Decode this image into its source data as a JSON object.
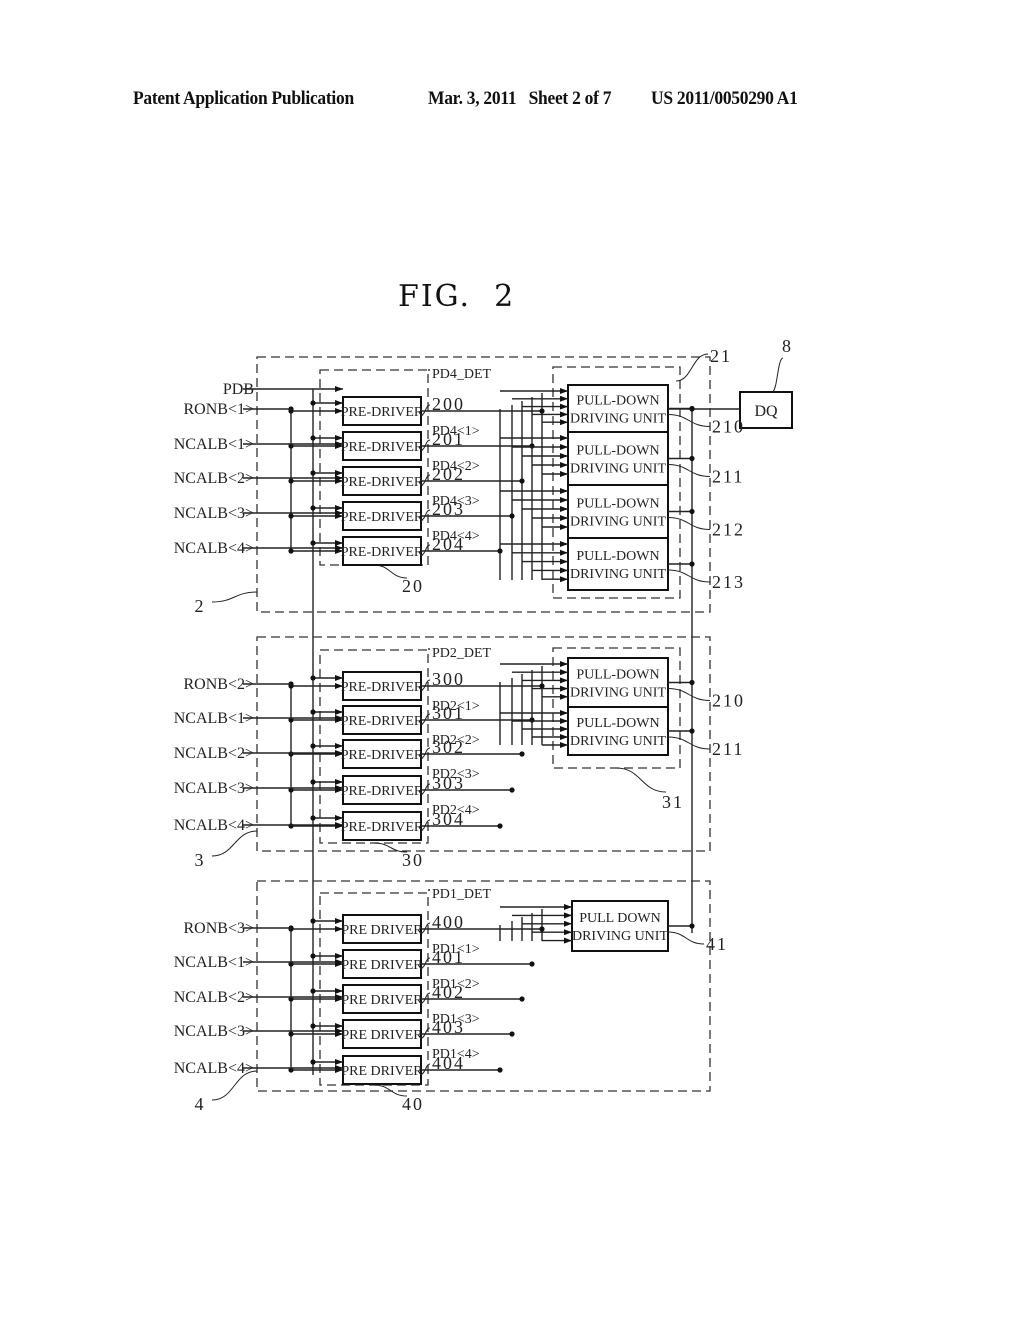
{
  "header": {
    "publication": "Patent Application Publication",
    "date_sheet": "Mar. 3, 2011   Sheet 2 of 7",
    "number": "US 2011/0050290 A1"
  },
  "figure": {
    "title": "FIG.  2",
    "dq": {
      "label": "DQ",
      "ref": "8"
    },
    "blocks": [
      {
        "ref": "2",
        "det_label": "PD4_DET",
        "predriver_group_ref": "20",
        "pulldown_group_ref": "21",
        "inputs": [
          "PDB",
          "RONB<1>",
          "NCALB<1>",
          "NCALB<2>",
          "NCALB<3>",
          "NCALB<4>"
        ],
        "predrivers": [
          {
            "label": "PRE-DRIVER",
            "ref": "200"
          },
          {
            "label": "PRE-DRIVER",
            "ref": "201"
          },
          {
            "label": "PRE-DRIVER",
            "ref": "202"
          },
          {
            "label": "PRE-DRIVER",
            "ref": "203"
          },
          {
            "label": "PRE-DRIVER",
            "ref": "204"
          }
        ],
        "signals": [
          "PD4<1>",
          "PD4<2>",
          "PD4<3>",
          "PD4<4>"
        ],
        "pulldowns": [
          {
            "line1": "PULL-DOWN",
            "line2": "DRIVING UNIT",
            "ref": "210"
          },
          {
            "line1": "PULL-DOWN",
            "line2": "DRIVING UNIT",
            "ref": "211"
          },
          {
            "line1": "PULL-DOWN",
            "line2": "DRIVING UNIT",
            "ref": "212"
          },
          {
            "line1": "PULL-DOWN",
            "line2": "DRIVING UNIT",
            "ref": "213"
          }
        ]
      },
      {
        "ref": "3",
        "det_label": "PD2_DET",
        "predriver_group_ref": "30",
        "pulldown_group_ref": "31",
        "inputs": [
          "RONB<2>",
          "NCALB<1>",
          "NCALB<2>",
          "NCALB<3>",
          "NCALB<4>"
        ],
        "predrivers": [
          {
            "label": "PRE-DRIVER",
            "ref": "300"
          },
          {
            "label": "PRE-DRIVER",
            "ref": "301"
          },
          {
            "label": "PRE-DRIVER",
            "ref": "302"
          },
          {
            "label": "PRE-DRIVER",
            "ref": "303"
          },
          {
            "label": "PRE-DRIVER",
            "ref": "304"
          }
        ],
        "signals": [
          "PD2<1>",
          "PD2<2>",
          "PD2<3>",
          "PD2<4>"
        ],
        "pulldowns": [
          {
            "line1": "PULL-DOWN",
            "line2": "DRIVING UNIT",
            "ref": "210"
          },
          {
            "line1": "PULL-DOWN",
            "line2": "DRIVING UNIT",
            "ref": "211"
          }
        ]
      },
      {
        "ref": "4",
        "det_label": "PD1_DET",
        "predriver_group_ref": "40",
        "pulldown_group_ref": "41",
        "inputs": [
          "RONB<3>",
          "NCALB<1>",
          "NCALB<2>",
          "NCALB<3>",
          "NCALB<4>"
        ],
        "predrivers": [
          {
            "label": "PRE DRIVER",
            "ref": "400"
          },
          {
            "label": "PRE DRIVER",
            "ref": "401"
          },
          {
            "label": "PRE DRIVER",
            "ref": "402"
          },
          {
            "label": "PRE DRIVER",
            "ref": "403"
          },
          {
            "label": "PRE DRIVER",
            "ref": "404"
          }
        ],
        "signals": [
          "PD1<1>",
          "PD1<2>",
          "PD1<3>",
          "PD1<4>"
        ],
        "pulldowns": [
          {
            "line1": "PULL DOWN",
            "line2": "DRIVING UNIT",
            "ref": "41"
          }
        ]
      }
    ]
  }
}
